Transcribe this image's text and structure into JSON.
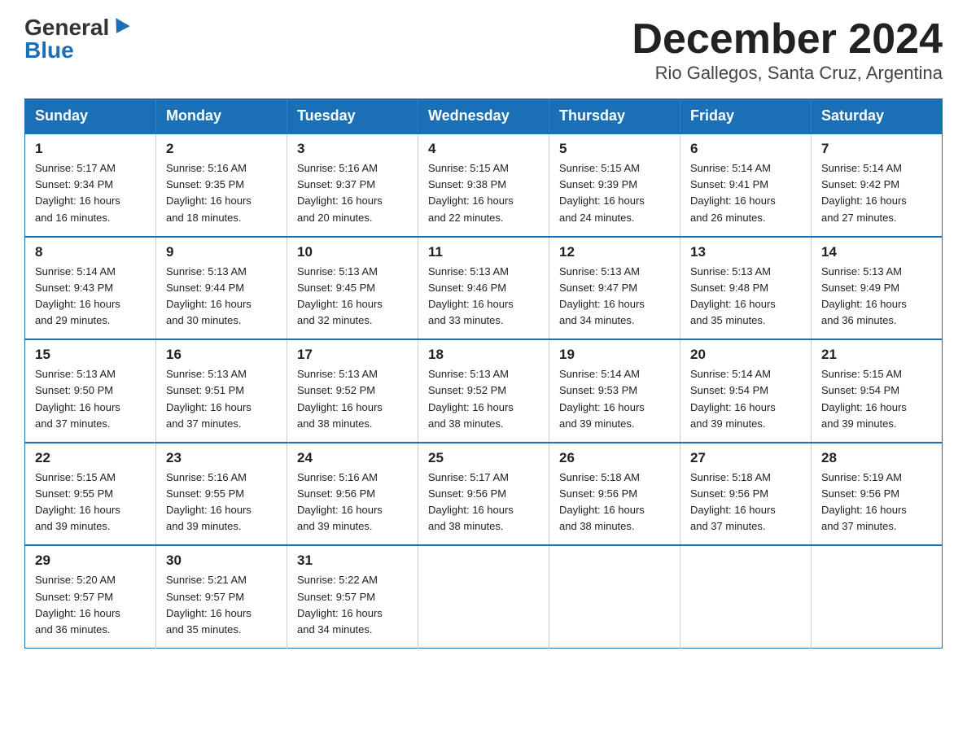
{
  "logo": {
    "general": "General",
    "blue": "Blue"
  },
  "title": "December 2024",
  "location": "Rio Gallegos, Santa Cruz, Argentina",
  "headers": [
    "Sunday",
    "Monday",
    "Tuesday",
    "Wednesday",
    "Thursday",
    "Friday",
    "Saturday"
  ],
  "weeks": [
    [
      {
        "day": "1",
        "sunrise": "5:17 AM",
        "sunset": "9:34 PM",
        "daylight": "16 hours and 16 minutes."
      },
      {
        "day": "2",
        "sunrise": "5:16 AM",
        "sunset": "9:35 PM",
        "daylight": "16 hours and 18 minutes."
      },
      {
        "day": "3",
        "sunrise": "5:16 AM",
        "sunset": "9:37 PM",
        "daylight": "16 hours and 20 minutes."
      },
      {
        "day": "4",
        "sunrise": "5:15 AM",
        "sunset": "9:38 PM",
        "daylight": "16 hours and 22 minutes."
      },
      {
        "day": "5",
        "sunrise": "5:15 AM",
        "sunset": "9:39 PM",
        "daylight": "16 hours and 24 minutes."
      },
      {
        "day": "6",
        "sunrise": "5:14 AM",
        "sunset": "9:41 PM",
        "daylight": "16 hours and 26 minutes."
      },
      {
        "day": "7",
        "sunrise": "5:14 AM",
        "sunset": "9:42 PM",
        "daylight": "16 hours and 27 minutes."
      }
    ],
    [
      {
        "day": "8",
        "sunrise": "5:14 AM",
        "sunset": "9:43 PM",
        "daylight": "16 hours and 29 minutes."
      },
      {
        "day": "9",
        "sunrise": "5:13 AM",
        "sunset": "9:44 PM",
        "daylight": "16 hours and 30 minutes."
      },
      {
        "day": "10",
        "sunrise": "5:13 AM",
        "sunset": "9:45 PM",
        "daylight": "16 hours and 32 minutes."
      },
      {
        "day": "11",
        "sunrise": "5:13 AM",
        "sunset": "9:46 PM",
        "daylight": "16 hours and 33 minutes."
      },
      {
        "day": "12",
        "sunrise": "5:13 AM",
        "sunset": "9:47 PM",
        "daylight": "16 hours and 34 minutes."
      },
      {
        "day": "13",
        "sunrise": "5:13 AM",
        "sunset": "9:48 PM",
        "daylight": "16 hours and 35 minutes."
      },
      {
        "day": "14",
        "sunrise": "5:13 AM",
        "sunset": "9:49 PM",
        "daylight": "16 hours and 36 minutes."
      }
    ],
    [
      {
        "day": "15",
        "sunrise": "5:13 AM",
        "sunset": "9:50 PM",
        "daylight": "16 hours and 37 minutes."
      },
      {
        "day": "16",
        "sunrise": "5:13 AM",
        "sunset": "9:51 PM",
        "daylight": "16 hours and 37 minutes."
      },
      {
        "day": "17",
        "sunrise": "5:13 AM",
        "sunset": "9:52 PM",
        "daylight": "16 hours and 38 minutes."
      },
      {
        "day": "18",
        "sunrise": "5:13 AM",
        "sunset": "9:52 PM",
        "daylight": "16 hours and 38 minutes."
      },
      {
        "day": "19",
        "sunrise": "5:14 AM",
        "sunset": "9:53 PM",
        "daylight": "16 hours and 39 minutes."
      },
      {
        "day": "20",
        "sunrise": "5:14 AM",
        "sunset": "9:54 PM",
        "daylight": "16 hours and 39 minutes."
      },
      {
        "day": "21",
        "sunrise": "5:15 AM",
        "sunset": "9:54 PM",
        "daylight": "16 hours and 39 minutes."
      }
    ],
    [
      {
        "day": "22",
        "sunrise": "5:15 AM",
        "sunset": "9:55 PM",
        "daylight": "16 hours and 39 minutes."
      },
      {
        "day": "23",
        "sunrise": "5:16 AM",
        "sunset": "9:55 PM",
        "daylight": "16 hours and 39 minutes."
      },
      {
        "day": "24",
        "sunrise": "5:16 AM",
        "sunset": "9:56 PM",
        "daylight": "16 hours and 39 minutes."
      },
      {
        "day": "25",
        "sunrise": "5:17 AM",
        "sunset": "9:56 PM",
        "daylight": "16 hours and 38 minutes."
      },
      {
        "day": "26",
        "sunrise": "5:18 AM",
        "sunset": "9:56 PM",
        "daylight": "16 hours and 38 minutes."
      },
      {
        "day": "27",
        "sunrise": "5:18 AM",
        "sunset": "9:56 PM",
        "daylight": "16 hours and 37 minutes."
      },
      {
        "day": "28",
        "sunrise": "5:19 AM",
        "sunset": "9:56 PM",
        "daylight": "16 hours and 37 minutes."
      }
    ],
    [
      {
        "day": "29",
        "sunrise": "5:20 AM",
        "sunset": "9:57 PM",
        "daylight": "16 hours and 36 minutes."
      },
      {
        "day": "30",
        "sunrise": "5:21 AM",
        "sunset": "9:57 PM",
        "daylight": "16 hours and 35 minutes."
      },
      {
        "day": "31",
        "sunrise": "5:22 AM",
        "sunset": "9:57 PM",
        "daylight": "16 hours and 34 minutes."
      },
      null,
      null,
      null,
      null
    ]
  ],
  "labels": {
    "sunrise": "Sunrise:",
    "sunset": "Sunset:",
    "daylight": "Daylight:"
  }
}
